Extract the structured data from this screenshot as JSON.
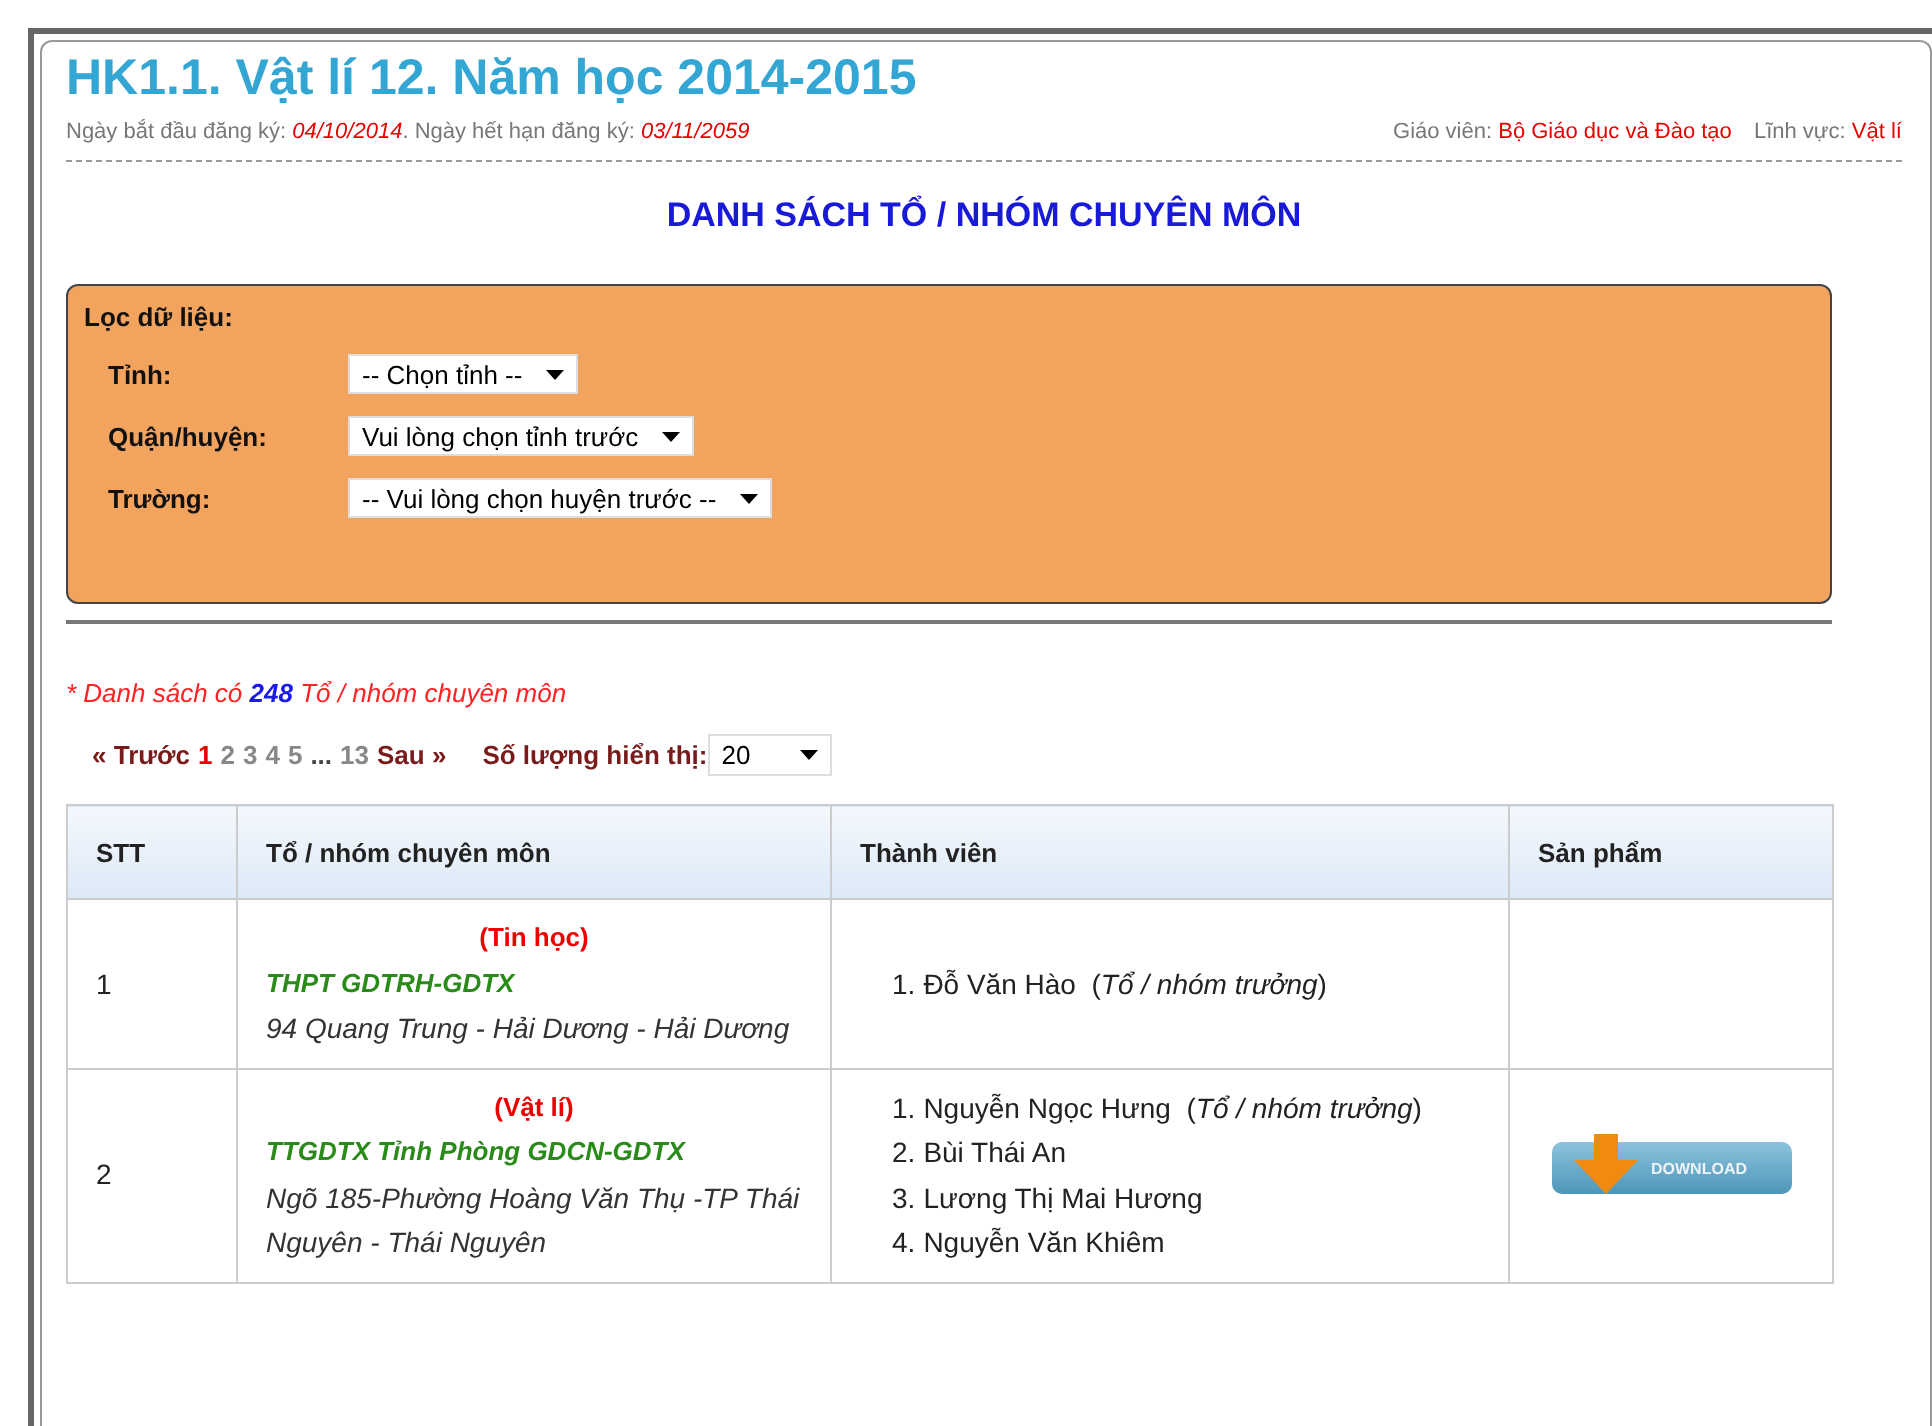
{
  "title": "HK1.1. Vật lí 12. Năm học 2014-2015",
  "meta": {
    "start_label": "Ngày bắt đầu đăng ký:",
    "start_date": "04/10/2014",
    "end_label": ". Ngày hết hạn đăng ký:",
    "end_date": "03/11/2059",
    "teacher_label": "Giáo viên:",
    "teacher": "Bộ Giáo dục và Đào tạo",
    "field_label": "Lĩnh vực:",
    "field": "Vật lí"
  },
  "heading": "DANH SÁCH TỔ / NHÓM CHUYÊN MÔN",
  "filter": {
    "title": "Lọc dữ liệu:",
    "fields": [
      {
        "label": "Tỉnh:",
        "value": "-- Chọn tỉnh --"
      },
      {
        "label": "Quận/huyện:",
        "value": "Vui lòng chọn tỉnh trước"
      },
      {
        "label": "Trường:",
        "value": "-- Vui lòng chọn huyện trước --"
      }
    ]
  },
  "count_note": "* Danh sách có **248** Tổ / nhóm chuyên môn",
  "pagination": [
    {
      "kind": "nav",
      "label": "« Trước",
      "selected": false
    },
    {
      "kind": "page",
      "label": "1",
      "selected": true
    },
    {
      "kind": "page",
      "label": "2",
      "selected": false
    },
    {
      "kind": "page",
      "label": "3",
      "selected": false
    },
    {
      "kind": "page",
      "label": "4",
      "selected": false
    },
    {
      "kind": "page",
      "label": "5",
      "selected": false
    },
    {
      "kind": "gap",
      "label": "...",
      "selected": false
    },
    {
      "kind": "page",
      "label": "13",
      "selected": false
    },
    {
      "kind": "nav",
      "label": "Sau »",
      "selected": false
    }
  ],
  "page_size": {
    "label": "Số lượng hiển thị:",
    "value": "20"
  },
  "table": {
    "columns": [
      "STT",
      "Tổ / nhóm chuyên môn",
      "Thành viên",
      "Sản phẩm"
    ],
    "rows": [
      {
        "stt": "1",
        "subject": "(Tin học)",
        "school": "THPT GDTRH-GDTX",
        "address": "94 Quang Trung - Hải Dương - Hải Dương",
        "members": [
          {
            "number": "1.",
            "text": "Đỗ Văn Hào  (*Tổ / nhóm trưởng*)"
          }
        ]
      },
      {
        "stt": "2",
        "subject": "(Vật lí)",
        "school": "TTGDTX Tỉnh Phòng GDCN-GDTX",
        "address": "Ngõ 185-Phường Hoàng Văn Thụ -TP Thái Nguyên - Thái Nguyên",
        "members": [
          {
            "number": "1.",
            "text": "Nguyễn Ngọc Hưng  (*Tổ / nhóm trưởng*)"
          },
          {
            "number": "2.",
            "text": "Bùi Thái An"
          },
          {
            "number": "3.",
            "text": "Lương Thị Mai Hương"
          },
          {
            "number": "4.",
            "text": "Nguyễn Văn Khiêm"
          }
        ],
        "product": {
          "label": "DOWNLOAD"
        }
      }
    ]
  }
}
